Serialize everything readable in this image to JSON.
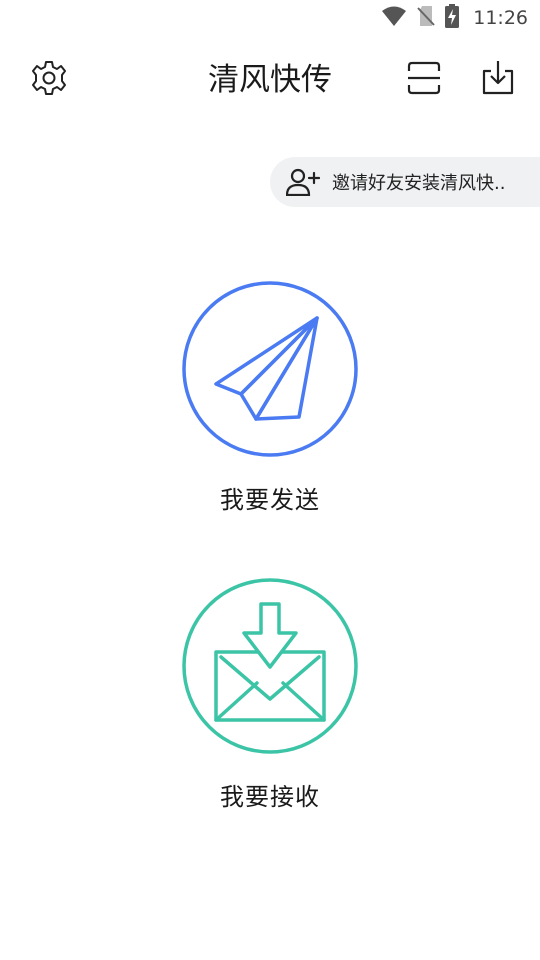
{
  "status_bar": {
    "time": "11:26",
    "icons": [
      "wifi-icon",
      "no-sim-icon",
      "battery-charging-icon"
    ]
  },
  "app_bar": {
    "title": "清风快传",
    "left_icon": "gear-icon",
    "right_icons": [
      "scan-icon",
      "download-icon"
    ]
  },
  "invite": {
    "icon": "add-user-icon",
    "label": "邀请好友安装清风快.."
  },
  "actions": {
    "send": {
      "label": "我要发送",
      "icon": "paper-plane-icon",
      "color": "#4a7bf2"
    },
    "receive": {
      "label": "我要接收",
      "icon": "mail-download-icon",
      "color": "#3cc4a6"
    }
  }
}
